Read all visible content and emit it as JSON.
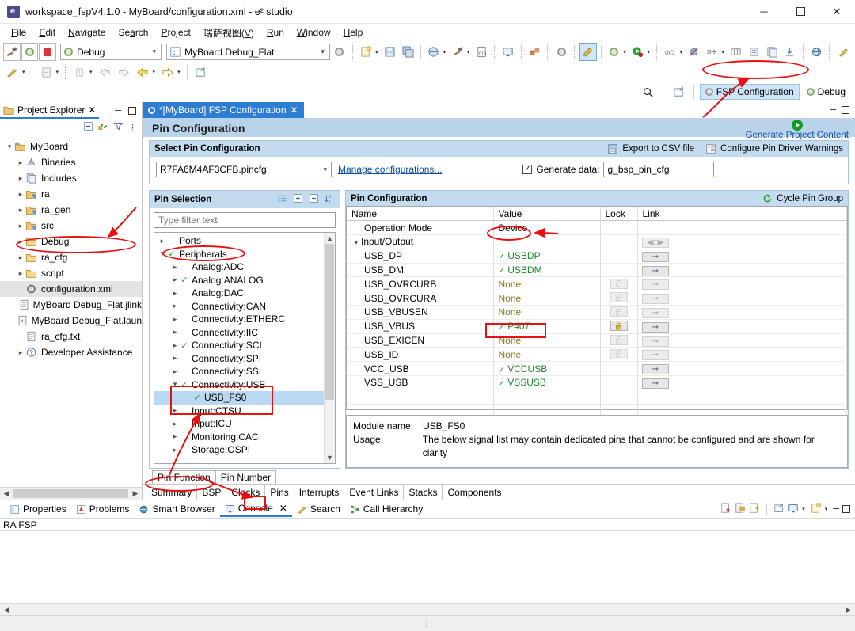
{
  "window": {
    "title": "workspace_fspV4.1.0 - MyBoard/configuration.xml - e² studio",
    "app_icon": "eclipse-icon",
    "minimize": "─",
    "maximize": "☐",
    "close": "✕"
  },
  "menu": {
    "items": [
      "File",
      "Edit",
      "Navigate",
      "Search",
      "Project",
      "瑞萨视图(V)",
      "Run",
      "Window",
      "Help"
    ]
  },
  "toolbar": {
    "build_icon": "hammer-icon",
    "debug_icon": "debug-bug-icon",
    "stop_icon": "stop-icon",
    "launch_mode": "Debug",
    "launch_config": "MyBoard Debug_Flat",
    "launch_config_icon": "c-file-icon",
    "search_icon": "search-icon",
    "open_perspective_icon": "open-perspective-icon",
    "perspectives": [
      {
        "label": "FSP Configuration",
        "icon": "gear-icon",
        "active": true
      },
      {
        "label": "Debug",
        "icon": "debug-bug-icon",
        "active": false
      }
    ]
  },
  "project_explorer": {
    "tab_label": "Project Explorer",
    "tab_icon": "project-explorer-icon",
    "close_icon": "✕",
    "tools": [
      "collapse-all-icon",
      "link-with-editor-icon",
      "view-filter-icon",
      "view-menu-icon"
    ],
    "minimize_icon": "─",
    "maximize_icon": "☐",
    "tree": [
      {
        "label": "MyBoard",
        "depth": 0,
        "twisty": "v",
        "icon": "project-icon",
        "selected": false
      },
      {
        "label": "Binaries",
        "depth": 1,
        "twisty": ">",
        "icon": "binaries-icon",
        "selected": false
      },
      {
        "label": "Includes",
        "depth": 1,
        "twisty": ">",
        "icon": "includes-icon",
        "selected": false
      },
      {
        "label": "ra",
        "depth": 1,
        "twisty": ">",
        "icon": "src-folder-icon",
        "selected": false
      },
      {
        "label": "ra_gen",
        "depth": 1,
        "twisty": ">",
        "icon": "src-folder-icon",
        "selected": false
      },
      {
        "label": "src",
        "depth": 1,
        "twisty": ">",
        "icon": "src-folder-icon",
        "selected": false
      },
      {
        "label": "Debug",
        "depth": 1,
        "twisty": ">",
        "icon": "folder-icon",
        "selected": false
      },
      {
        "label": "ra_cfg",
        "depth": 1,
        "twisty": ">",
        "icon": "folder-icon",
        "selected": false
      },
      {
        "label": "script",
        "depth": 1,
        "twisty": ">",
        "icon": "folder-icon",
        "selected": false
      },
      {
        "label": "configuration.xml",
        "depth": 1,
        "twisty": "",
        "icon": "gear-file-icon",
        "selected": true
      },
      {
        "label": "MyBoard Debug_Flat.jlink",
        "depth": 1,
        "twisty": "",
        "icon": "text-file-icon",
        "selected": false
      },
      {
        "label": "MyBoard Debug_Flat.laun",
        "depth": 1,
        "twisty": "",
        "icon": "launch-file-icon",
        "selected": false
      },
      {
        "label": "ra_cfg.txt",
        "depth": 1,
        "twisty": "",
        "icon": "text-file-icon",
        "selected": false
      },
      {
        "label": "Developer Assistance",
        "depth": 1,
        "twisty": ">",
        "icon": "help-icon",
        "selected": false
      }
    ]
  },
  "editor": {
    "tab_label": "*[MyBoard] FSP Configuration",
    "tab_icon": "gear-icon",
    "tab_close": "✕",
    "minimize_icon": "─",
    "maximize_icon": "☐",
    "page_title": "Pin Configuration",
    "generate": {
      "label": "Generate Project Content",
      "icon": "play-icon"
    },
    "select_section": {
      "title": "Select Pin Configuration",
      "export_csv": "Export to CSV file",
      "export_csv_icon": "export-csv-icon",
      "configure_warnings": "Configure Pin Driver Warnings",
      "configure_warnings_icon": "warnings-icon",
      "pincfg_value": "R7FA6M4AF3CFB.pincfg",
      "manage_link": "Manage configurations...",
      "generate_data_label": "Generate data:",
      "generate_data_checked": true,
      "generate_data_value": "g_bsp_pin_cfg"
    },
    "pin_selection": {
      "title": "Pin Selection",
      "tools": [
        "list-view-icon",
        "expand-all-icon",
        "collapse-all-icon",
        "sort-az-icon"
      ],
      "filter_placeholder": "Type filter text",
      "tree": [
        {
          "label": "Ports",
          "depth": 0,
          "twisty": ">",
          "check": false,
          "selected": false
        },
        {
          "label": "Peripherals",
          "depth": 0,
          "twisty": "v",
          "check": true,
          "selected": false
        },
        {
          "label": "Analog:ADC",
          "depth": 1,
          "twisty": ">",
          "check": false,
          "selected": false
        },
        {
          "label": "Analog:ANALOG",
          "depth": 1,
          "twisty": ">",
          "check": true,
          "selected": false
        },
        {
          "label": "Analog:DAC",
          "depth": 1,
          "twisty": ">",
          "check": false,
          "selected": false
        },
        {
          "label": "Connectivity:CAN",
          "depth": 1,
          "twisty": ">",
          "check": false,
          "selected": false
        },
        {
          "label": "Connectivity:ETHERC",
          "depth": 1,
          "twisty": ">",
          "check": false,
          "selected": false
        },
        {
          "label": "Connectivity:IIC",
          "depth": 1,
          "twisty": ">",
          "check": false,
          "selected": false
        },
        {
          "label": "Connectivity:SCI",
          "depth": 1,
          "twisty": ">",
          "check": true,
          "selected": false
        },
        {
          "label": "Connectivity:SPI",
          "depth": 1,
          "twisty": ">",
          "check": false,
          "selected": false
        },
        {
          "label": "Connectivity:SSI",
          "depth": 1,
          "twisty": ">",
          "check": false,
          "selected": false
        },
        {
          "label": "Connectivity:USB",
          "depth": 1,
          "twisty": "v",
          "check": true,
          "selected": false
        },
        {
          "label": "USB_FS0",
          "depth": 2,
          "twisty": "",
          "check": true,
          "selected": true
        },
        {
          "label": "Input:CTSU",
          "depth": 1,
          "twisty": ">",
          "check": false,
          "selected": false
        },
        {
          "label": "Input:ICU",
          "depth": 1,
          "twisty": ">",
          "check": false,
          "selected": false
        },
        {
          "label": "Monitoring:CAC",
          "depth": 1,
          "twisty": ">",
          "check": false,
          "selected": false
        },
        {
          "label": "Storage:OSPI",
          "depth": 1,
          "twisty": ">",
          "check": false,
          "selected": false
        }
      ]
    },
    "pin_configuration": {
      "title": "Pin Configuration",
      "cycle_pin_group": "Cycle Pin Group",
      "cycle_pin_group_icon": "cycle-icon",
      "columns": [
        "Name",
        "Value",
        "Lock",
        "Link"
      ],
      "rows": [
        {
          "name": "Operation Mode",
          "indent": 1,
          "twisty": "",
          "value": "Device",
          "value_state": "plain",
          "lock": "none",
          "link": "none"
        },
        {
          "name": "Input/Output",
          "indent": 0,
          "twisty": "v",
          "value": "",
          "value_state": "plain",
          "lock": "none",
          "link": "group"
        },
        {
          "name": "USB_DP",
          "indent": 1,
          "twisty": "",
          "value": "USBDP",
          "value_state": "ok",
          "lock": "none",
          "link": "arrow"
        },
        {
          "name": "USB_DM",
          "indent": 1,
          "twisty": "",
          "value": "USBDM",
          "value_state": "ok",
          "lock": "none",
          "link": "arrow"
        },
        {
          "name": "USB_OVRCURB",
          "indent": 1,
          "twisty": "",
          "value": "None",
          "value_state": "none",
          "lock": "disabled",
          "link": "arrow-dim"
        },
        {
          "name": "USB_OVRCURA",
          "indent": 1,
          "twisty": "",
          "value": "None",
          "value_state": "none",
          "lock": "disabled",
          "link": "arrow-dim"
        },
        {
          "name": "USB_VBUSEN",
          "indent": 1,
          "twisty": "",
          "value": "None",
          "value_state": "none",
          "lock": "disabled",
          "link": "arrow-dim"
        },
        {
          "name": "USB_VBUS",
          "indent": 1,
          "twisty": "",
          "value": "P407",
          "value_state": "ok",
          "lock": "unlocked",
          "link": "arrow"
        },
        {
          "name": "USB_EXICEN",
          "indent": 1,
          "twisty": "",
          "value": "None",
          "value_state": "none",
          "lock": "disabled",
          "link": "arrow-dim"
        },
        {
          "name": "USB_ID",
          "indent": 1,
          "twisty": "",
          "value": "None",
          "value_state": "none",
          "lock": "disabled",
          "link": "arrow-dim"
        },
        {
          "name": "VCC_USB",
          "indent": 1,
          "twisty": "",
          "value": "VCCUSB",
          "value_state": "ok",
          "lock": "none",
          "link": "arrow"
        },
        {
          "name": "VSS_USB",
          "indent": 1,
          "twisty": "",
          "value": "VSSUSB",
          "value_state": "ok",
          "lock": "none",
          "link": "arrow"
        }
      ],
      "module": {
        "module_name_label": "Module name:",
        "module_name_value": "USB_FS0",
        "usage_label": "Usage:",
        "usage_value": "The below signal list may contain dedicated pins that cannot be configured and are shown for clarity"
      }
    },
    "sub_tabs": [
      {
        "label": "Pin Function",
        "active": true
      },
      {
        "label": "Pin Number",
        "active": false
      }
    ],
    "bottom_tabs": [
      {
        "label": "Summary",
        "active": false
      },
      {
        "label": "BSP",
        "active": false
      },
      {
        "label": "Clocks",
        "active": false
      },
      {
        "label": "Pins",
        "active": true
      },
      {
        "label": "Interrupts",
        "active": false
      },
      {
        "label": "Event Links",
        "active": false
      },
      {
        "label": "Stacks",
        "active": false
      },
      {
        "label": "Components",
        "active": false
      }
    ]
  },
  "bottom_view": {
    "tabs": [
      {
        "label": "Properties",
        "icon": "properties-icon",
        "active": false
      },
      {
        "label": "Problems",
        "icon": "problems-icon",
        "active": false
      },
      {
        "label": "Smart Browser",
        "icon": "smart-browser-icon",
        "active": false
      },
      {
        "label": "Console",
        "icon": "console-icon",
        "active": true
      },
      {
        "label": "Search",
        "icon": "search-view-icon",
        "active": false
      },
      {
        "label": "Call Hierarchy",
        "icon": "call-hierarchy-icon",
        "active": false
      }
    ],
    "close_icon": "✕",
    "tools": [
      "clear-console-icon",
      "scroll-lock-icon",
      "pin-console-icon",
      "display-selected-console-icon",
      "open-console-icon",
      "new-console-view-icon"
    ],
    "minimize_icon": "─",
    "maximize_icon": "☐",
    "console_name": "RA FSP",
    "console_text": ""
  },
  "annotations": {
    "color": "#e81010",
    "marks": [
      "fsp-configuration-perspective",
      "configuration-xml-file",
      "peripherals-node",
      "connectivity-usb-node",
      "usb-fs0-node",
      "operation-mode-device-value",
      "usb-vbus-p407-value",
      "pin-function-tab",
      "pins-tab"
    ]
  }
}
